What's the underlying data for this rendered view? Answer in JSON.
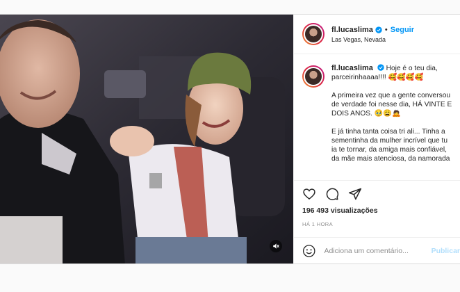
{
  "post": {
    "username": "fl.lucaslima",
    "follow_label": "Seguir",
    "location": "Las Vegas, Nevada",
    "separator": "•"
  },
  "caption": {
    "line1": "Hoje é o teu dia,",
    "line2": "parceirinhaaaa!!!! 🥰🥰🥰🥰",
    "p2": [
      "A primeira vez que a gente conversou",
      "de verdade foi nesse dia, HÁ VINTE E",
      "DOIS ANOS. 🥹😩🙇"
    ],
    "p3": [
      "E já tinha tanta coisa tri ali... Tinha a",
      "sementinha da mulher incrível que tu",
      "ia te tornar, da amiga mais confiável,",
      "da mãe mais atenciosa, da namorada"
    ]
  },
  "stats": {
    "views": "196 493 visualizações",
    "time": "HÁ 1 HORA"
  },
  "comment": {
    "placeholder": "Adiciona um comentário...",
    "publish_label": "Publicar"
  },
  "icons": {
    "verified": "verified-badge-icon",
    "mute": "speaker-muted-icon",
    "like": "heart-icon",
    "comment": "comment-bubble-icon",
    "share": "paper-plane-icon",
    "emoji": "smiley-icon"
  },
  "colors": {
    "accent": "#0095f6",
    "publish_disabled": "#b2dffc",
    "muted_text": "#8e8e8e"
  }
}
